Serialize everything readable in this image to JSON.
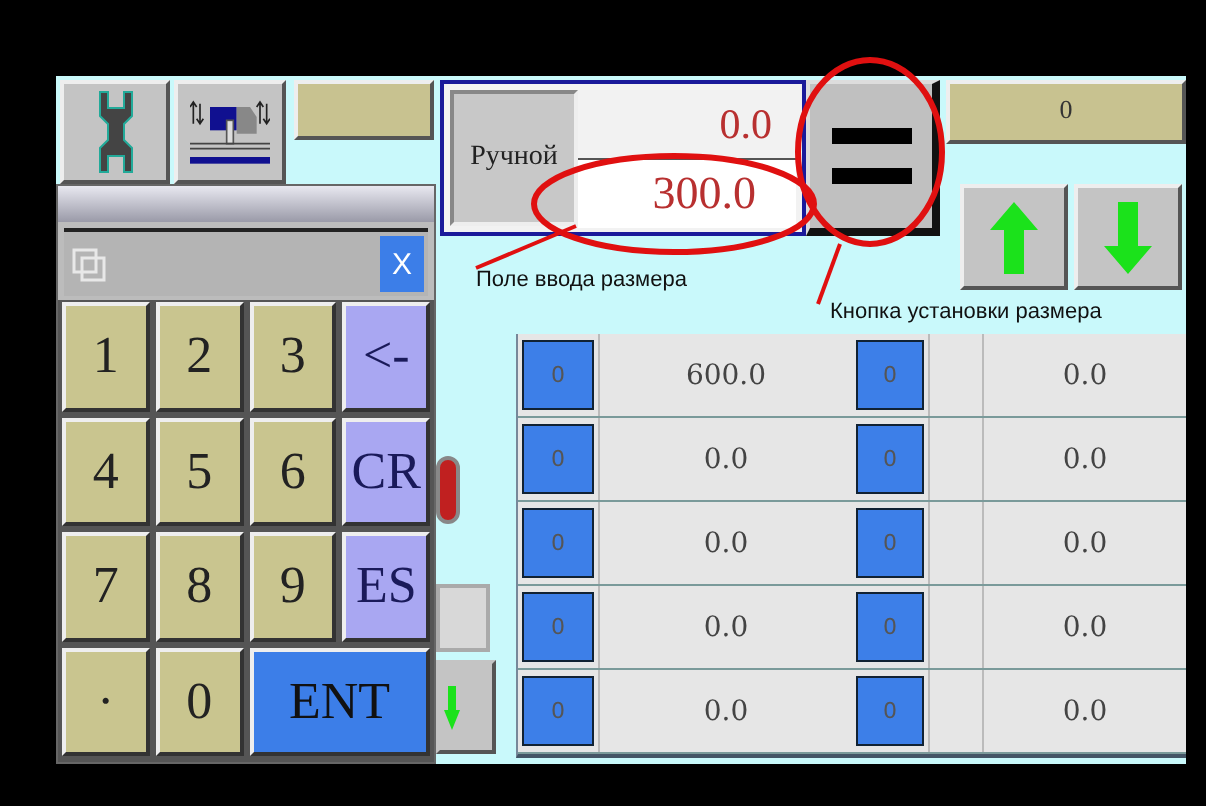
{
  "mode": {
    "button": "Ручной",
    "current": "0.0",
    "input": "300.0"
  },
  "counter": "0",
  "labels": [
    {
      "kind": "field",
      "text": "Поле ввода размера"
    },
    {
      "kind": "button",
      "text": "Кнопка установки размера"
    }
  ],
  "table": {
    "rows": [
      {
        "index_1": "0",
        "value_1": "600.0",
        "index_2": "0",
        "value_2": "0.0"
      },
      {
        "index_1": "0",
        "value_1": "0.0",
        "index_2": "0",
        "value_2": "0.0"
      },
      {
        "index_1": "0",
        "value_1": "0.0",
        "index_2": "0",
        "value_2": "0.0"
      },
      {
        "index_1": "0",
        "value_1": "0.0",
        "index_2": "0",
        "value_2": "0.0"
      },
      {
        "index_1": "0",
        "value_1": "0.0",
        "index_2": "0",
        "value_2": "0.0"
      }
    ]
  },
  "keypad": {
    "close": "X",
    "keys": [
      {
        "label": "1",
        "kind": "digit"
      },
      {
        "label": "2",
        "kind": "digit"
      },
      {
        "label": "3",
        "kind": "digit"
      },
      {
        "label": "<-",
        "kind": "function"
      },
      {
        "label": "4",
        "kind": "digit"
      },
      {
        "label": "5",
        "kind": "digit"
      },
      {
        "label": "6",
        "kind": "digit"
      },
      {
        "label": "CR",
        "kind": "function"
      },
      {
        "label": "7",
        "kind": "digit"
      },
      {
        "label": "8",
        "kind": "digit"
      },
      {
        "label": "9",
        "kind": "digit"
      },
      {
        "label": "ES",
        "kind": "function"
      },
      {
        "label": "·",
        "kind": "digit"
      },
      {
        "label": "0",
        "kind": "digit"
      },
      {
        "label": "ENT",
        "kind": "enter"
      }
    ]
  }
}
